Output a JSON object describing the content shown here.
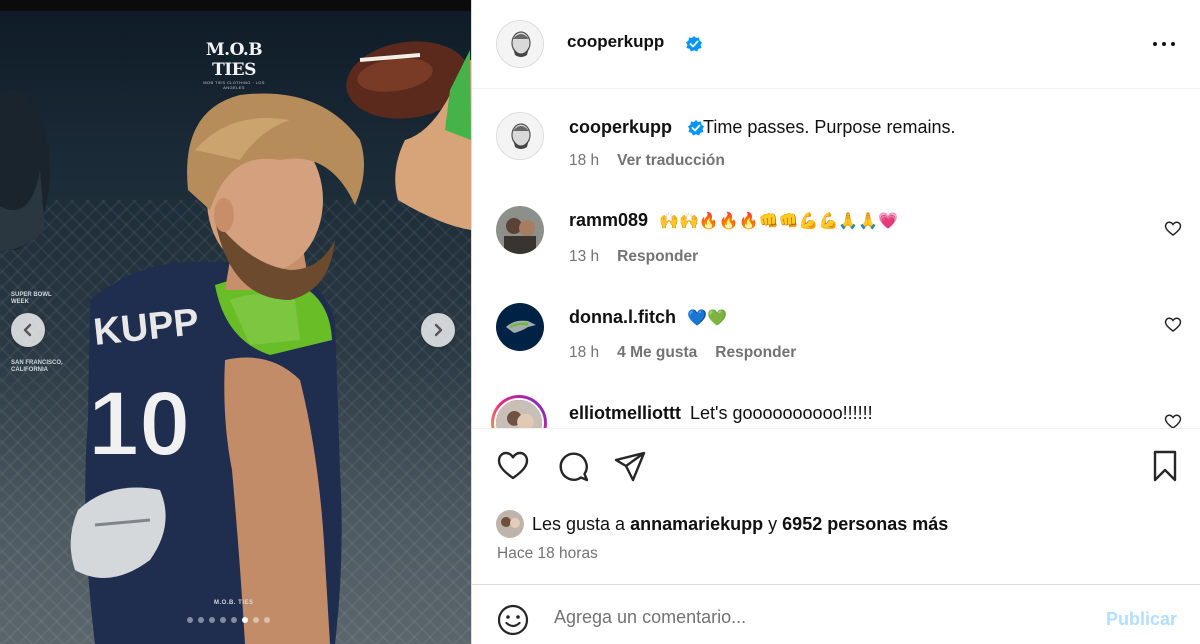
{
  "media": {
    "brand_logo_text": "M.O.B TIES",
    "brand_logo_subtext": "MOB TIES CLOTHING · LOS ANGELES",
    "side_text_top": "SUPER BOWL\nWEEK",
    "side_text_bottom": "SAN FRANCISCO,\nCALIFORNIA",
    "jersey_name": "KUPP",
    "jersey_number": "10",
    "footer_mark": "M.O.B. TIES",
    "carousel": {
      "total": 8,
      "active_index": 5
    }
  },
  "post": {
    "author": "cooperkupp",
    "caption": "Time passes. Purpose remains.",
    "caption_time": "18 h",
    "translate_label": "Ver traducción",
    "verified_color": "#0095f6"
  },
  "comments": [
    {
      "user": "ramm089",
      "text": "🙌🙌🔥🔥🔥👊👊💪💪🙏🙏💗",
      "time": "13 h",
      "likes": "",
      "reply": "Responder"
    },
    {
      "user": "donna.l.fitch",
      "text": "💙💚",
      "time": "18 h",
      "likes": "4 Me gusta",
      "reply": "Responder"
    },
    {
      "user": "elliotmelliottt",
      "text": "Let's goooooooooo!!!!!!",
      "time": "",
      "likes": "",
      "reply": ""
    }
  ],
  "likes": {
    "prefix": "Les gusta a",
    "user": "annamariekupp",
    "connector": "y",
    "count_text": "6952 personas más"
  },
  "posted_ago": "Hace 18 horas",
  "add_comment": {
    "placeholder": "Agrega un comentario...",
    "publish_label": "Publicar"
  }
}
